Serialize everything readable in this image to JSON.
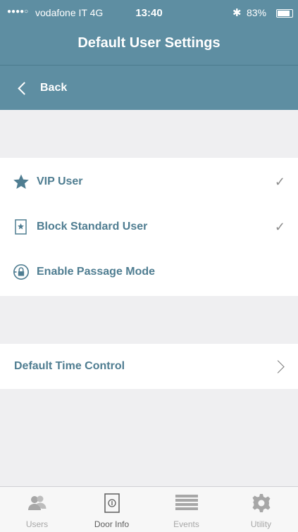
{
  "status_bar": {
    "carrier": "vodafone IT  4G",
    "time": "13:40",
    "bluetooth": "✱",
    "battery": "83%"
  },
  "header": {
    "title": "Default User Settings",
    "back_label": "Back"
  },
  "options": [
    {
      "label": "VIP User",
      "icon": "star-icon",
      "checked": true
    },
    {
      "label": "Block Standard User",
      "icon": "star-card-icon",
      "checked": true
    },
    {
      "label": "Enable Passage Mode",
      "icon": "passage-lock-icon",
      "checked": false
    }
  ],
  "default_time_control": {
    "label": "Default Time Control"
  },
  "tabs": [
    {
      "label": "Users",
      "icon": "users-icon",
      "active": false
    },
    {
      "label": "Door Info",
      "icon": "door-icon",
      "active": true
    },
    {
      "label": "Events",
      "icon": "list-icon",
      "active": false
    },
    {
      "label": "Utility",
      "icon": "gear-icon",
      "active": false
    }
  ],
  "colors": {
    "accent": "#5e8ea2",
    "label": "#4f7d91",
    "background": "#efeff1"
  }
}
